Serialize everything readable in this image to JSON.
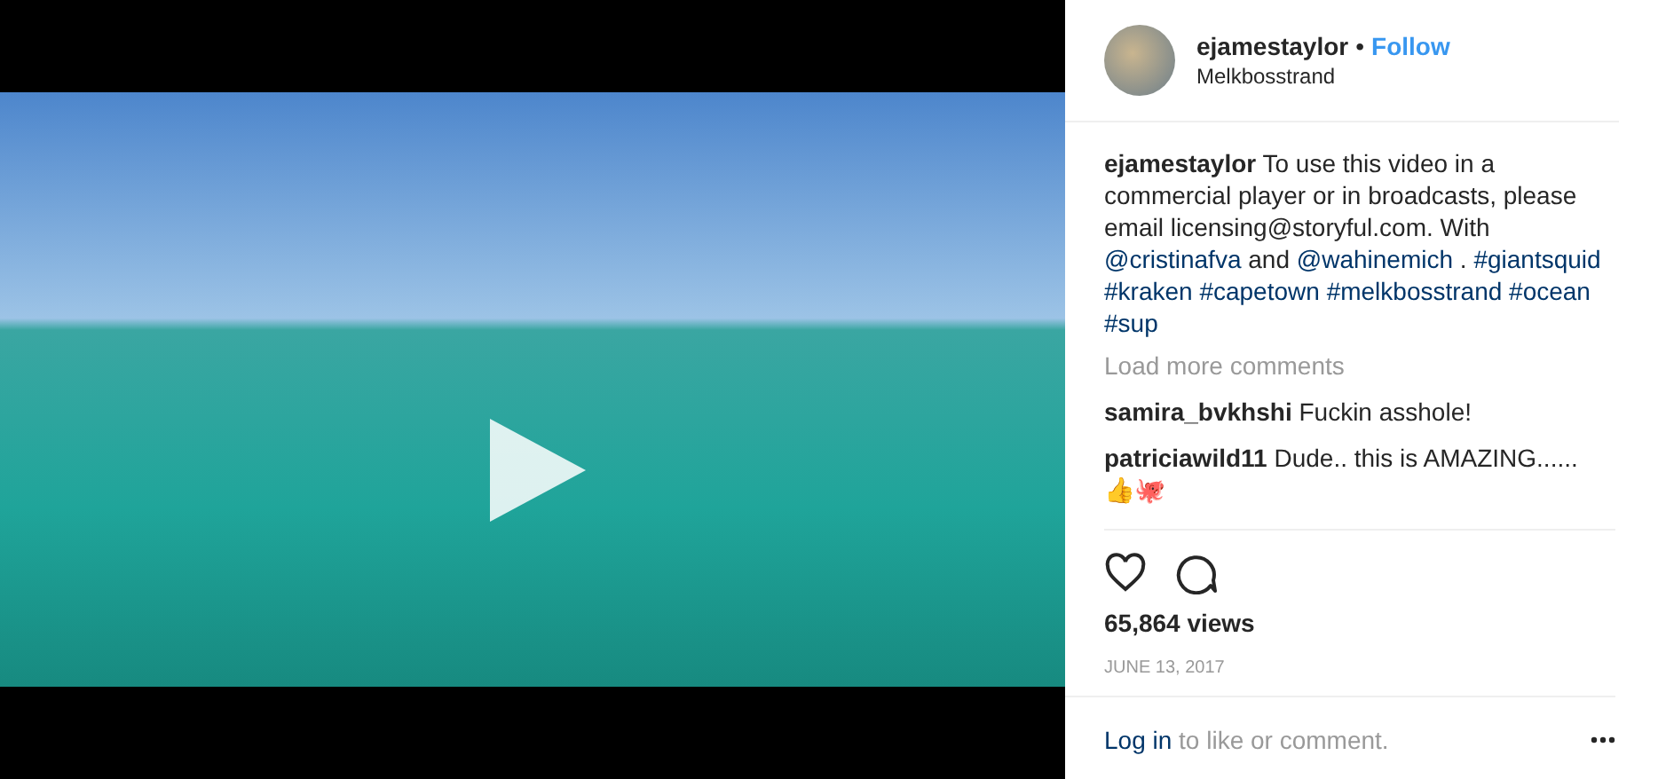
{
  "header": {
    "username": "ejamestaylor",
    "separator": "•",
    "follow": "Follow",
    "location": "Melkbosstrand"
  },
  "caption": [
    {
      "kind": "author",
      "text": "ejamestaylor"
    },
    {
      "kind": "text",
      "text": " To use this video in a commercial player or in broadcasts, please email licensing@storyful.com. With "
    },
    {
      "kind": "mention",
      "text": "@cristinafva"
    },
    {
      "kind": "text",
      "text": " and "
    },
    {
      "kind": "mention",
      "text": "@wahinemich"
    },
    {
      "kind": "text",
      "text": " . "
    },
    {
      "kind": "hashtag",
      "text": "#giantsquid"
    },
    {
      "kind": "hashtag",
      "text": "#kraken"
    },
    {
      "kind": "hashtag",
      "text": "#capetown"
    },
    {
      "kind": "hashtag",
      "text": "#melkbosstrand"
    },
    {
      "kind": "hashtag",
      "text": "#ocean"
    },
    {
      "kind": "hashtag",
      "text": "#sup"
    }
  ],
  "load_more": "Load more comments",
  "comments": [
    {
      "user": "samira_bvkhshi",
      "text": "Fuckin asshole!"
    },
    {
      "user": "patriciawild11",
      "text": "Dude.. this is AMAZING...... 👍🐙"
    }
  ],
  "views": "65,864 views",
  "date": "JUNE 13, 2017",
  "footer": {
    "link": "Log in",
    "text": "to like or comment."
  }
}
